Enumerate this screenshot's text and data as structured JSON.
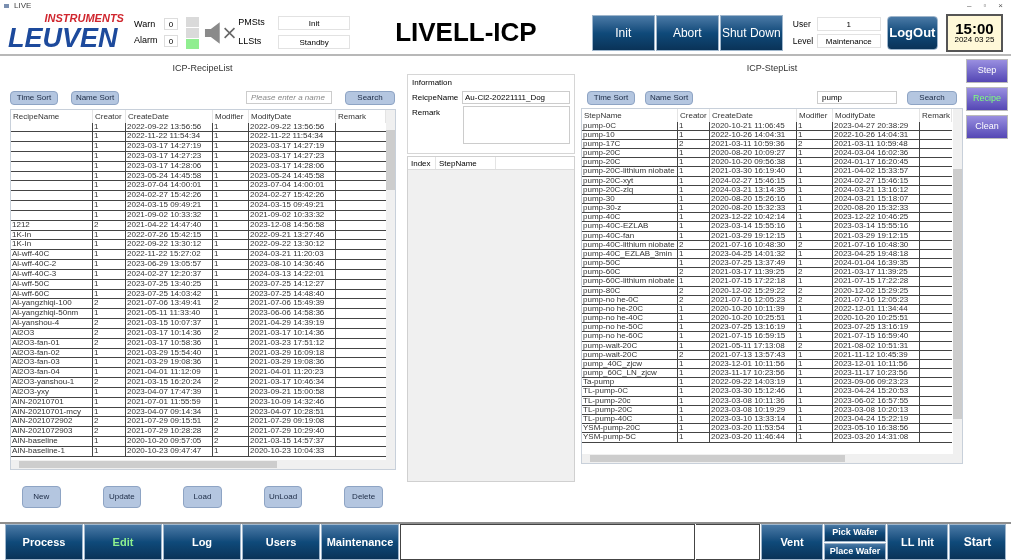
{
  "window": {
    "title": "LIVE",
    "controls": [
      "–",
      "▫",
      "×"
    ]
  },
  "header": {
    "logo": {
      "top": "INSTRUMENTS",
      "main": "LEUVEN"
    },
    "counters": [
      {
        "label": "Warn",
        "value": "0"
      },
      {
        "label": "Alarm",
        "value": "0"
      }
    ],
    "tower_lights": [
      {
        "on": false
      },
      {
        "on": false
      },
      {
        "on": true
      }
    ],
    "sound": {
      "muted": true
    },
    "statuses": [
      {
        "label": "PMSts",
        "value": "Init"
      },
      {
        "label": "LLSts",
        "value": "Standby"
      }
    ],
    "title": "LIVELL-ICP",
    "actions": [
      "Init",
      "Abort",
      "Shut Down"
    ],
    "user": [
      {
        "label": "User",
        "value": "1"
      },
      {
        "label": "Level",
        "value": "Maintenance"
      }
    ],
    "logout": "LogOut",
    "clock": {
      "time": "15:00",
      "date": "2024 03 25"
    }
  },
  "recipe_list": {
    "title": "ICP-RecipeList",
    "sort_buttons": [
      "Time Sort",
      "Name Sort"
    ],
    "search": {
      "placeholder": "Please enter a name",
      "button": "Search"
    },
    "columns": [
      "RecipeName",
      "Creator",
      "CreateDate",
      "Modifier",
      "ModifyDate",
      "Remark"
    ],
    "rows": [
      {
        "creator": "1",
        "created": "2022-09-22 13:56:56",
        "modifier": "1",
        "modified": "2022-09-22 13:56:56"
      },
      {
        "creator": "1",
        "created": "2022-11-22 11:54:34",
        "modifier": "1",
        "modified": "2022-11-22 11:54:34"
      },
      {
        "creator": "1",
        "created": "2023-03-17 14:27:19",
        "modifier": "1",
        "modified": "2023-03-17 14:27:19"
      },
      {
        "creator": "1",
        "created": "2023-03-17 14:27:23",
        "modifier": "1",
        "modified": "2023-03-17 14:27:23"
      },
      {
        "creator": "1",
        "created": "2023-03-17 14:28:06",
        "modifier": "1",
        "modified": "2023-03-17 14:28:06"
      },
      {
        "creator": "1",
        "created": "2023-05-24 14:45:58",
        "modifier": "1",
        "modified": "2023-05-24 14:45:58"
      },
      {
        "creator": "1",
        "created": "2023-07-04 14:00:01",
        "modifier": "1",
        "modified": "2023-07-04 14:00:01"
      },
      {
        "creator": "1",
        "created": "2024-02-27 15:42:26",
        "modifier": "1",
        "modified": "2024-02-27 15:42:26"
      },
      {
        "creator": "1",
        "created": "2024-03-15 09:49:21",
        "modifier": "1",
        "modified": "2024-03-15 09:49:21"
      },
      {
        "creator": "1",
        "created": "2021-09-02 10:33:32",
        "modifier": "1",
        "modified": "2021-09-02 10:33:32"
      },
      {
        "name": "1212",
        "creator": "2",
        "created": "2021-04-22 14:47:40",
        "modifier": "1",
        "modified": "2023-12-08 14:56:58"
      },
      {
        "name": "1K-In",
        "creator": "1",
        "created": "2022-07-26 15:42:15",
        "modifier": "1",
        "modified": "2022-09-21 13:27:46"
      },
      {
        "name": "1K-In",
        "creator": "1",
        "created": "2022-09-22 13:30:12",
        "modifier": "1",
        "modified": "2022-09-22 13:30:12"
      },
      {
        "name": "Al-wff-40C",
        "creator": "1",
        "created": "2022-11-22 15:27:02",
        "modifier": "1",
        "modified": "2024-03-21 11:20:03"
      },
      {
        "name": "Al-wff-40C-2",
        "creator": "1",
        "created": "2023-06-29 13:05:57",
        "modifier": "1",
        "modified": "2023-08-10 14:36:46"
      },
      {
        "name": "Al-wff-40C-3",
        "creator": "1",
        "created": "2024-02-27 12:20:37",
        "modifier": "1",
        "modified": "2024-03-13 14:22:01"
      },
      {
        "name": "Al-wff-50C",
        "creator": "1",
        "created": "2023-07-25 13:40:25",
        "modifier": "1",
        "modified": "2023-07-25 14:12:27"
      },
      {
        "name": "Al-wff-60C",
        "creator": "1",
        "created": "2023-07-25 14:03:42",
        "modifier": "1",
        "modified": "2023-07-25 14:48:40"
      },
      {
        "name": "Al-yangzhiqi-100",
        "creator": "2",
        "created": "2021-07-06 13:49:41",
        "modifier": "2",
        "modified": "2021-07-06 15:49:39"
      },
      {
        "name": "Al-yangzhiqi-50nm",
        "creator": "1",
        "created": "2021-05-11 11:33:40",
        "modifier": "1",
        "modified": "2023-06-06 14:58:36"
      },
      {
        "name": "Al-yanshou-4",
        "creator": "2",
        "created": "2021-03-15 10:07:37",
        "modifier": "1",
        "modified": "2021-04-29 14:39:19"
      },
      {
        "name": "Al2O3",
        "creator": "2",
        "created": "2021-03-17 10:14:36",
        "modifier": "2",
        "modified": "2021-03-17 10:14:36"
      },
      {
        "name": "Al2O3-fan-01",
        "creator": "2",
        "created": "2021-03-17 10:58:36",
        "modifier": "1",
        "modified": "2021-03-23 17:51:12"
      },
      {
        "name": "Al2O3-fan-02",
        "creator": "1",
        "created": "2021-03-29 15:54:40",
        "modifier": "1",
        "modified": "2021-03-29 16:09:18"
      },
      {
        "name": "Al2O3-fan-03",
        "creator": "1",
        "created": "2021-03-29 19:08:36",
        "modifier": "1",
        "modified": "2021-03-29 19:08:36"
      },
      {
        "name": "Al2O3-fan-04",
        "creator": "1",
        "created": "2021-04-01 11:12:09",
        "modifier": "1",
        "modified": "2021-04-01 11:20:23"
      },
      {
        "name": "Al2O3-yanshou-1",
        "creator": "2",
        "created": "2021-03-15 16:20:24",
        "modifier": "2",
        "modified": "2021-03-17 10:46:34"
      },
      {
        "name": "Al2O3-yxy",
        "creator": "1",
        "created": "2023-04-07 17:47:39",
        "modifier": "1",
        "modified": "2023-09-21 15:00:58"
      },
      {
        "name": "AIN-20210701",
        "creator": "1",
        "created": "2021-07-01 11:55:59",
        "modifier": "1",
        "modified": "2023-10-09 14:32:46"
      },
      {
        "name": "AIN-20210701-mcy",
        "creator": "1",
        "created": "2023-04-07 09:14:34",
        "modifier": "1",
        "modified": "2023-04-07 10:28:51"
      },
      {
        "name": "AIN-2021072902",
        "creator": "2",
        "created": "2021-07-29 09:15:51",
        "modifier": "2",
        "modified": "2021-07-29 09:19:08"
      },
      {
        "name": "AIN-2021072903",
        "creator": "2",
        "created": "2021-07-29 10:28:28",
        "modifier": "2",
        "modified": "2021-07-29 10:29:40"
      },
      {
        "name": "AIN-baseline",
        "creator": "1",
        "created": "2020-10-20 09:57:05",
        "modifier": "2",
        "modified": "2021-03-15 14:57:37"
      },
      {
        "name": "AIN-baseline-1",
        "creator": "1",
        "created": "2020-10-23 09:47:47",
        "modifier": "1",
        "modified": "2020-10-23 10:04:33"
      }
    ],
    "buttons": [
      "New",
      "Update",
      "Load",
      "UnLoad",
      "Delete"
    ]
  },
  "information": {
    "title": "Information",
    "fields": [
      {
        "label": "ReicpeName",
        "value": "Au-Cl2-20221111_Dog"
      },
      {
        "label": "Remark"
      }
    ],
    "step_columns": [
      "Index",
      "StepName"
    ]
  },
  "step_list": {
    "title": "ICP-StepList",
    "sort_buttons": [
      "Time Sort",
      "Name Sort"
    ],
    "search": {
      "value": "pump",
      "button": "Search"
    },
    "columns": [
      "StepName",
      "Creator",
      "CreateDate",
      "Modifier",
      "ModifyDate",
      "Remark"
    ],
    "rows": [
      {
        "name": "pump-0C",
        "creator": "1",
        "created": "2020-10-21 11:06:45",
        "modifier": "1",
        "modified": "2023-04-27 20:38:29"
      },
      {
        "name": "pump-10",
        "creator": "1",
        "created": "2022-10-26 14:04:31",
        "modifier": "1",
        "modified": "2022-10-26 14:04:31"
      },
      {
        "name": "pump-17C",
        "creator": "2",
        "created": "2021-03-11 10:59:36",
        "modifier": "2",
        "modified": "2021-03-11 10:59:48"
      },
      {
        "name": "pump-20C",
        "creator": "1",
        "created": "2020-08-20 10:09:27",
        "modifier": "1",
        "modified": "2024-03-04 16:02:36"
      },
      {
        "name": "pump-20C",
        "creator": "1",
        "created": "2020-10-20 09:56:38",
        "modifier": "1",
        "modified": "2024-01-17 16:20:45"
      },
      {
        "name": "pump-20C-lithium niobate",
        "creator": "1",
        "created": "2021-03-30 16:19:40",
        "modifier": "1",
        "modified": "2021-04-02 15:33:57"
      },
      {
        "name": "pump-20C-xyt",
        "creator": "1",
        "created": "2024-02-27 15:46:15",
        "modifier": "1",
        "modified": "2024-02-27 15:46:15"
      },
      {
        "name": "pump-20C-zlq",
        "creator": "1",
        "created": "2024-03-21 13:14:35",
        "modifier": "1",
        "modified": "2024-03-21 13:16:12"
      },
      {
        "name": "pump-30",
        "creator": "1",
        "created": "2020-08-20 15:26:16",
        "modifier": "1",
        "modified": "2024-03-21 15:18:07"
      },
      {
        "name": "pump-30-z",
        "creator": "1",
        "created": "2020-08-20 15:32:33",
        "modifier": "1",
        "modified": "2020-08-20 15:32:33"
      },
      {
        "name": "pump-40C",
        "creator": "1",
        "created": "2023-12-22 10:42:14",
        "modifier": "1",
        "modified": "2023-12-22 10:46:25"
      },
      {
        "name": "pump-40C-EZLAB",
        "creator": "1",
        "created": "2023-03-14 15:55:16",
        "modifier": "1",
        "modified": "2023-03-14 15:55:16"
      },
      {
        "name": "pump-40C-fan",
        "creator": "1",
        "created": "2021-03-29 19:12:15",
        "modifier": "1",
        "modified": "2021-03-29 19:12:15"
      },
      {
        "name": "pump-40C-lithium niobate",
        "creator": "2",
        "created": "2021-07-16 10:48:30",
        "modifier": "2",
        "modified": "2021-07-16 10:48:30"
      },
      {
        "name": "pump-40C_EZLAB_3min",
        "creator": "1",
        "created": "2023-04-25 14:01:32",
        "modifier": "1",
        "modified": "2023-04-25 19:48:18"
      },
      {
        "name": "pump-50C",
        "creator": "1",
        "created": "2023-07-25 13:37:49",
        "modifier": "1",
        "modified": "2024-01-04 16:39:35"
      },
      {
        "name": "pump-60C",
        "creator": "2",
        "created": "2021-03-17 11:39:25",
        "modifier": "2",
        "modified": "2021-03-17 11:39:25"
      },
      {
        "name": "pump-60C-lithium niobate",
        "creator": "1",
        "created": "2021-07-15 17:22:18",
        "modifier": "1",
        "modified": "2021-07-15 17:22:28"
      },
      {
        "name": "pump-80C",
        "creator": "2",
        "created": "2020-12-02 15:29:22",
        "modifier": "2",
        "modified": "2020-12-02 15:29:25"
      },
      {
        "name": "pump-no he-0C",
        "creator": "2",
        "created": "2021-07-16 12:05:23",
        "modifier": "2",
        "modified": "2021-07-16 12:05:23"
      },
      {
        "name": "pump-no he-20C",
        "creator": "1",
        "created": "2020-10-20 10:11:39",
        "modifier": "1",
        "modified": "2022-12-01 11:34:44"
      },
      {
        "name": "pump-no he-40C",
        "creator": "1",
        "created": "2020-10-20 10:25:51",
        "modifier": "1",
        "modified": "2020-10-20 10:25:51"
      },
      {
        "name": "pump-no he-50C",
        "creator": "1",
        "created": "2023-07-25 13:16:19",
        "modifier": "1",
        "modified": "2023-07-25 13:16:19"
      },
      {
        "name": "pump-no he-60C",
        "creator": "1",
        "created": "2021-07-15 16:59:15",
        "modifier": "1",
        "modified": "2021-07-15 16:59:40"
      },
      {
        "name": "pump-wait-20C",
        "creator": "1",
        "created": "2021-05-11 17:13:08",
        "modifier": "2",
        "modified": "2021-08-02 10:51:31"
      },
      {
        "name": "pump-wait-20C",
        "creator": "2",
        "created": "2021-07-13 13:57:43",
        "modifier": "1",
        "modified": "2021-11-12 10:45:39"
      },
      {
        "name": "pump_40C_zjcw",
        "creator": "1",
        "created": "2023-12-01 10:11:56",
        "modifier": "1",
        "modified": "2023-12-01 10:11:56"
      },
      {
        "name": "pump_60C_LN_zjcw",
        "creator": "1",
        "created": "2023-11-17 10:23:56",
        "modifier": "1",
        "modified": "2023-11-17 10:23:56"
      },
      {
        "name": "Ta-pump",
        "creator": "1",
        "created": "2022-09-22 14:03:19",
        "modifier": "1",
        "modified": "2023-09-06 09:23:23"
      },
      {
        "name": "TL-pump-0C",
        "creator": "1",
        "created": "2023-03-30 15:12:46",
        "modifier": "1",
        "modified": "2023-04-24 15:20:53"
      },
      {
        "name": "TL-pump-20c",
        "creator": "1",
        "created": "2023-03-08 10:11:36",
        "modifier": "1",
        "modified": "2023-06-02 16:57:55"
      },
      {
        "name": "TL-pump-20C",
        "creator": "1",
        "created": "2023-03-08 10:19:29",
        "modifier": "1",
        "modified": "2023-03-08 10:20:13"
      },
      {
        "name": "TL-pump-40C",
        "creator": "1",
        "created": "2023-03-10 13:33:14",
        "modifier": "1",
        "modified": "2023-04-24 15:22:19"
      },
      {
        "name": "YSM-pump-20C",
        "creator": "1",
        "created": "2023-03-20 11:53:54",
        "modifier": "1",
        "modified": "2023-05-10 16:38:56"
      },
      {
        "name": "YSM-pump-5C",
        "creator": "1",
        "created": "2023-03-20 11:46:44",
        "modifier": "1",
        "modified": "2023-03-20 14:31:08"
      }
    ]
  },
  "side_tabs": [
    {
      "label": "Step",
      "selected": false
    },
    {
      "label": "Recipe",
      "selected": true
    },
    {
      "label": "Clean",
      "selected": false
    }
  ],
  "bottom_nav": [
    {
      "label": "Process",
      "selected": false
    },
    {
      "label": "Edit",
      "selected": true
    },
    {
      "label": "Log",
      "selected": false
    },
    {
      "label": "Users",
      "selected": false
    },
    {
      "label": "Maintenance",
      "selected": false
    }
  ],
  "bottom_actions": {
    "vent": "Vent",
    "wafer": [
      "Pick Wafer",
      "Place Wafer"
    ],
    "ll_init": "LL Init",
    "start": "Start"
  }
}
